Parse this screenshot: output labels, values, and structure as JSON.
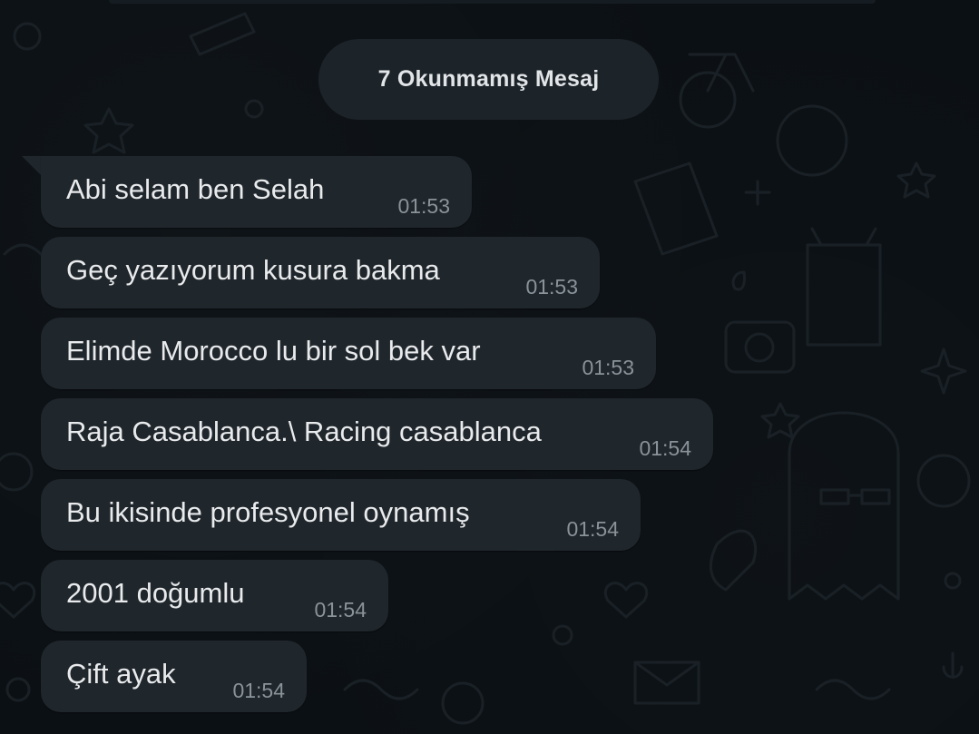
{
  "unread_banner": "7 Okunmamış Mesaj",
  "messages": [
    {
      "text": "Abi selam ben Selah",
      "time": "01:53"
    },
    {
      "text": "Geç yazıyorum kusura bakma",
      "time": "01:53"
    },
    {
      "text": "Elimde Morocco lu bir sol bek var",
      "time": "01:53"
    },
    {
      "text": "Raja Casablanca.\\ Racing casablanca",
      "time": "01:54"
    },
    {
      "text": "Bu ikisinde profesyonel oynamış",
      "time": "01:54"
    },
    {
      "text": "2001 doğumlu",
      "time": "01:54"
    },
    {
      "text": "Çift ayak",
      "time": "01:54"
    }
  ],
  "colors": {
    "background": "#0b1014",
    "bubble": "#1f262c",
    "banner": "#1c2329",
    "text": "#e8eaec",
    "time": "#8a9399"
  }
}
